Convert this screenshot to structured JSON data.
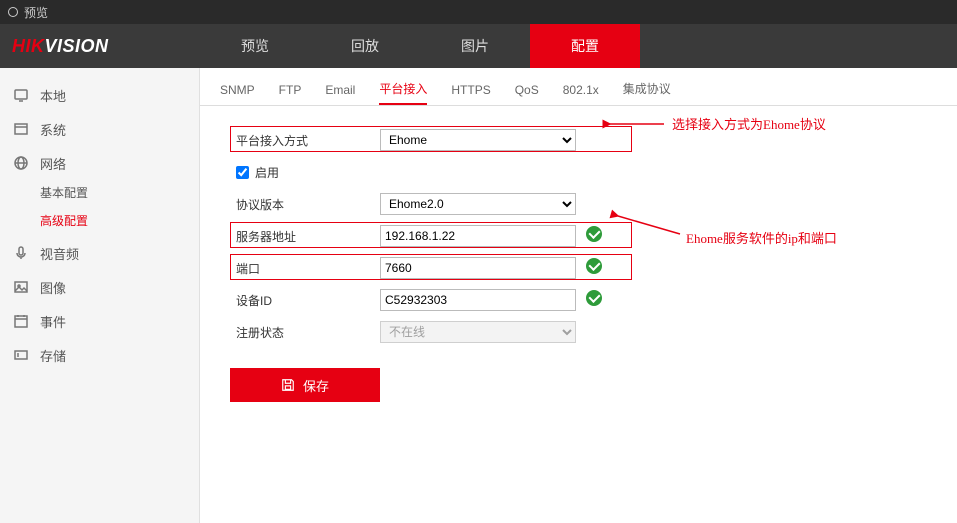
{
  "titlebar": {
    "title": "预览"
  },
  "logo": {
    "prefix": "HIK",
    "suffix": "VISION"
  },
  "main_nav": [
    {
      "label": "预览",
      "key": "preview"
    },
    {
      "label": "回放",
      "key": "playback"
    },
    {
      "label": "图片",
      "key": "picture"
    },
    {
      "label": "配置",
      "key": "config",
      "active": true
    }
  ],
  "sidebar": [
    {
      "label": "本地",
      "key": "local",
      "icon": "monitor"
    },
    {
      "label": "系统",
      "key": "system",
      "icon": "window"
    },
    {
      "label": "网络",
      "key": "network",
      "icon": "globe",
      "children": [
        {
          "label": "基本配置",
          "key": "basic"
        },
        {
          "label": "高级配置",
          "key": "advanced",
          "active": true
        }
      ]
    },
    {
      "label": "视音频",
      "key": "av",
      "icon": "mic"
    },
    {
      "label": "图像",
      "key": "image",
      "icon": "picture"
    },
    {
      "label": "事件",
      "key": "event",
      "icon": "calendar"
    },
    {
      "label": "存储",
      "key": "storage",
      "icon": "storage"
    }
  ],
  "sub_tabs": [
    "SNMP",
    "FTP",
    "Email",
    "平台接入",
    "HTTPS",
    "QoS",
    "802.1x",
    "集成协议"
  ],
  "sub_tab_active": "平台接入",
  "form": {
    "access_method": {
      "label": "平台接入方式",
      "value": "Ehome"
    },
    "enable": {
      "label": "启用",
      "checked": true
    },
    "protocol_version": {
      "label": "协议版本",
      "value": "Ehome2.0"
    },
    "server_addr": {
      "label": "服务器地址",
      "value": "192.168.1.22",
      "valid": true
    },
    "port": {
      "label": "端口",
      "value": "7660",
      "valid": true
    },
    "device_id": {
      "label": "设备ID",
      "value": "C52932303",
      "valid": true
    },
    "reg_status": {
      "label": "注册状态",
      "value": "不在线"
    }
  },
  "save_label": "保存",
  "annotations": {
    "a1": "选择接入方式为Ehome协议",
    "a2": "Ehome服务软件的ip和端口"
  }
}
